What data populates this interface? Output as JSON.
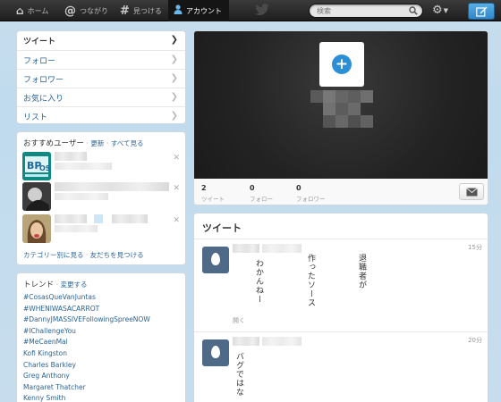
{
  "topbar": {
    "nav": [
      {
        "label": "ホーム",
        "icon": "home-icon"
      },
      {
        "label": "つながり",
        "icon": "at-icon"
      },
      {
        "label": "見つける",
        "icon": "hash-icon"
      },
      {
        "label": "アカウント",
        "icon": "person-icon",
        "active": true
      }
    ],
    "search_placeholder": "検索"
  },
  "sidebar": {
    "menu": [
      {
        "label": "ツイート",
        "active": true
      },
      {
        "label": "フォロー"
      },
      {
        "label": "フォロワー"
      },
      {
        "label": "お気に入り"
      },
      {
        "label": "リスト"
      }
    ]
  },
  "who_to_follow": {
    "title": "おすすめユーザー",
    "refresh": "更新",
    "view_all": "すべて見る",
    "footer_browse": "カテゴリー別に見る",
    "footer_find": "友だちを見つける"
  },
  "trends": {
    "title": "トレンド",
    "change": "変更する",
    "items": [
      "#CosasQueVanJuntas",
      "#WHENIWASACARROT",
      "#DannyJMASSIVEFollowingSpreeNOW",
      "#IChallengeYou",
      "#MeCaenMal",
      "Kofi Kingston",
      "Charles Barkley",
      "Greg Anthony",
      "Margaret Thatcher",
      "Kenny Smith"
    ]
  },
  "profile": {
    "stats": [
      {
        "num": "2",
        "label": "ツイート"
      },
      {
        "num": "0",
        "label": "フォロー"
      },
      {
        "num": "0",
        "label": "フォロワー"
      }
    ]
  },
  "timeline": {
    "title": "ツイート",
    "tweets": [
      {
        "time": "15分",
        "lines": [
          "わかんねー",
          "作ったソース",
          "退職者が"
        ],
        "expand": "開く"
      },
      {
        "time": "20分",
        "lines": [
          "バグではな"
        ]
      }
    ]
  }
}
